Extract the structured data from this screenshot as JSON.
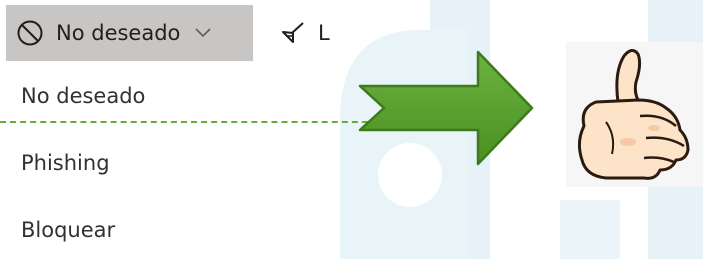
{
  "toolbar": {
    "junk_button": {
      "label": "No deseado",
      "icon": "block-icon",
      "chevron": "chevron-down-icon"
    },
    "sweep_button": {
      "label": "L",
      "icon": "broom-icon"
    }
  },
  "menu": {
    "items": [
      {
        "label": "No deseado"
      },
      {
        "label": "Phishing"
      },
      {
        "label": "Bloquear"
      }
    ]
  },
  "annotation": {
    "arrow": {
      "icon": "arrow-right-icon",
      "color": "#5aa02c"
    },
    "image": {
      "icon": "thumbs-up-icon"
    }
  },
  "colors": {
    "button_selected_bg": "#c8c6c4",
    "dash_line": "#6aaa3a",
    "watermark": "#dcecf5"
  }
}
